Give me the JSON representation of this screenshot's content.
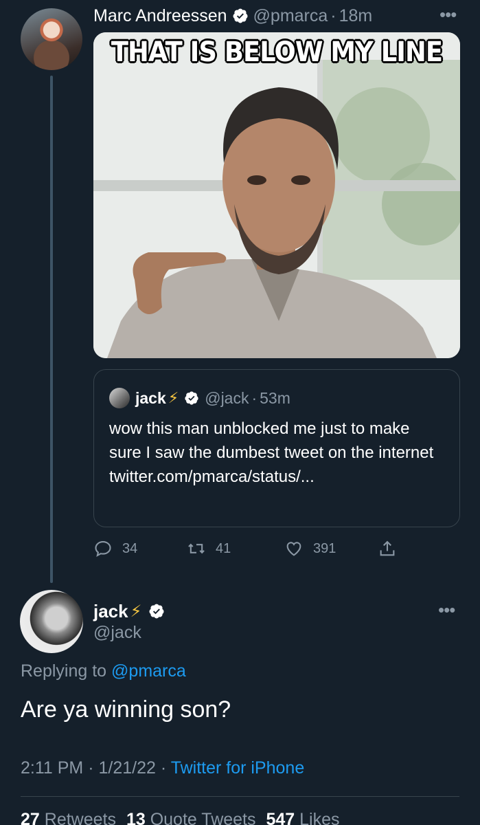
{
  "tweet1": {
    "author_name": "Marc Andreessen",
    "handle": "@pmarca",
    "separator": "·",
    "time_ago": "18m",
    "media_caption": "THAT IS BELOW MY LINE",
    "quoted": {
      "author_name": "jack",
      "handle": "@jack",
      "separator": "·",
      "time_ago": "53m",
      "text": "wow this man unblocked me just to make sure I saw the dumbest tweet on the internet twitter.com/pmarca/status/..."
    },
    "actions": {
      "replies": "34",
      "retweets": "41",
      "likes": "391"
    }
  },
  "tweet2": {
    "author_name": "jack",
    "handle": "@jack",
    "replying_prefix": "Replying to",
    "replying_to": "@pmarca",
    "text": "Are ya winning son?",
    "time": "2:11 PM",
    "date": "1/21/22",
    "separator": "·",
    "client": "Twitter for iPhone",
    "stats": {
      "retweets_count": "27",
      "retweets_label": "Retweets",
      "quotes_count": "13",
      "quotes_label": "Quote Tweets",
      "likes_count": "547",
      "likes_label": "Likes"
    }
  },
  "colors": {
    "background": "#15202b",
    "link": "#1d9bf0",
    "muted": "#8b98a5",
    "verified": "#ffffff",
    "bolt": "#f5c542"
  }
}
